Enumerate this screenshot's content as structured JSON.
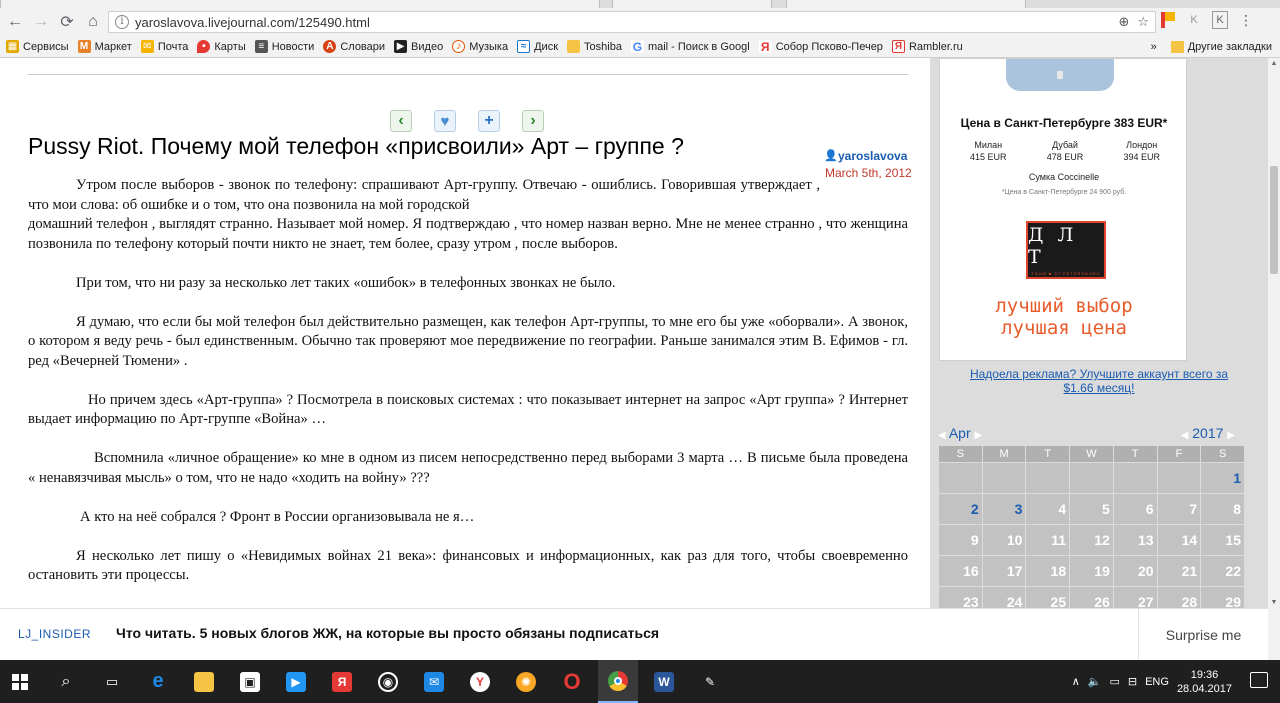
{
  "browser": {
    "url": "yaroslavova.livejournal.com/125490.html",
    "bookmarks": [
      {
        "label": "Сервисы",
        "icon": "apps-icon",
        "color": "#e0a800"
      },
      {
        "label": "Маркет",
        "icon": "market-icon",
        "color": "#e8822a"
      },
      {
        "label": "Почта",
        "icon": "mail-icon",
        "color": "#f4b400"
      },
      {
        "label": "Карты",
        "icon": "map-pin-icon",
        "color": "#e53935"
      },
      {
        "label": "Новости",
        "icon": "news-icon",
        "color": "#555555"
      },
      {
        "label": "Словари",
        "icon": "dictionary-icon",
        "color": "#d84315"
      },
      {
        "label": "Видео",
        "icon": "video-icon",
        "color": "#222222"
      },
      {
        "label": "Музыка",
        "icon": "music-icon",
        "color": "#e65100"
      },
      {
        "label": "Диск",
        "icon": "disk-icon",
        "color": "#1976d2"
      },
      {
        "label": "Toshiba",
        "icon": "folder-icon",
        "color": "#f6c445"
      },
      {
        "label": "mail - Поиск в Googl",
        "icon": "google-icon",
        "color": "#4285f4"
      },
      {
        "label": "Собор Псково-Печер",
        "icon": "yandex-icon",
        "color": "#e53935"
      },
      {
        "label": "Rambler.ru",
        "icon": "rambler-icon",
        "color": "#e53935"
      }
    ],
    "bookmarks_more": "»",
    "other_bookmarks": "Другие закладки"
  },
  "post": {
    "title": "Pussy Riot. Почему мой телефон «присвоили» Арт – группе ?",
    "author": "yaroslavova",
    "date": "March 5th, 2012",
    "paragraphs": [
      "Утром    после  выборов    - звонок по телефону: спрашивают  Арт-группу.  Отвечаю -  ошиблись.   Говорившая  утверждает , что   мои слова:     об  ошибке и о том, что она позвонила    на  мой  городской",
      "домашний  телефон   ,  выглядят  странно.  Называет  мой  номер.  Я  подтверждаю , что номер назван верно.   Мне не менее  странно , что  женщина   позвонила  по телефону  который   почти никто не знает, тем более,  сразу  утром ,  после выборов.",
      "При  том,  что  ни разу   за несколько  лет таких  «ошибок»  в телефонных звонках    не было.",
      "Я  думаю,  что если   бы мой  телефон  был действительно  размещен,   как телефон   Арт-группы, то  мне  его бы уже  «оборвали».  А  звонок, о котором я  веду речь  - был единственным.  Обычно так проверяют    мое передвижение по географии.   Раньше занимался этим   В. Ефимов  - гл.  ред  «Вечерней  Тюмени» .",
      "Но  причем    здесь  «Арт-группа» ?  Посмотрела  в поисковых системах : что   показывает интернет на  запрос «Арт  группа»  ?   Интернет  выдает информацию  по  Арт-группе  «Война» …",
      "Вспомнила   «личное обращение» ко мне   в одном из писем непосредственно   перед выборами  3 марта …  В письме  была проведена « ненавязчивая  мысль»  о том, что не надо  «ходить  на войну»   ???",
      "А кто на  неё  собрался ?      Фронт в России организовывала  не я…",
      "Я  несколько  лет пишу   о  «Невидимых войнах  21 века»: финансовых и информационных,  как  раз  для  того,  чтобы    своевременно  остановить эти процессы."
    ]
  },
  "ad": {
    "price_title": "Цена в Санкт-Петербурге 383 EUR*",
    "cities": [
      {
        "name": "Милан",
        "price": "415 EUR"
      },
      {
        "name": "Дубай",
        "price": "478 EUR"
      },
      {
        "name": "Лондон",
        "price": "394 EUR"
      }
    ],
    "item": "Сумка Coccinelle",
    "note": "*Цена в Санкт-Петербурге 24 900 руб.",
    "logo": "Д Л Т",
    "logo_sub": "TSUM ■ ST.PETERSBURG",
    "slogan_1": "лучший выбор",
    "slogan_2": "лучшая цена"
  },
  "adfree": {
    "line1": "Надоела реклама? Улучшите аккаунт всего за",
    "line2": "$1.66 месяц!"
  },
  "calendar": {
    "month": "Apr",
    "year": "2017",
    "weekdays": [
      "S",
      "M",
      "T",
      "W",
      "T",
      "F",
      "S"
    ],
    "weeks": [
      [
        "",
        "",
        "",
        "",
        "",
        "",
        "1"
      ],
      [
        "2",
        "3",
        "4",
        "5",
        "6",
        "7",
        "8"
      ],
      [
        "9",
        "10",
        "11",
        "12",
        "13",
        "14",
        "15"
      ],
      [
        "16",
        "17",
        "18",
        "19",
        "20",
        "21",
        "22"
      ],
      [
        "23",
        "24",
        "25",
        "26",
        "27",
        "28",
        "29"
      ]
    ],
    "linked_days": [
      "1",
      "2",
      "3"
    ]
  },
  "insider": {
    "tag": "LJ_INSIDER",
    "text": "Что читать. 5 новых блогов ЖЖ, на которые вы просто обязаны подписаться",
    "surprise": "Surprise me"
  },
  "taskbar": {
    "lang": "ENG",
    "time": "19:36",
    "date": "28.04.2017"
  }
}
